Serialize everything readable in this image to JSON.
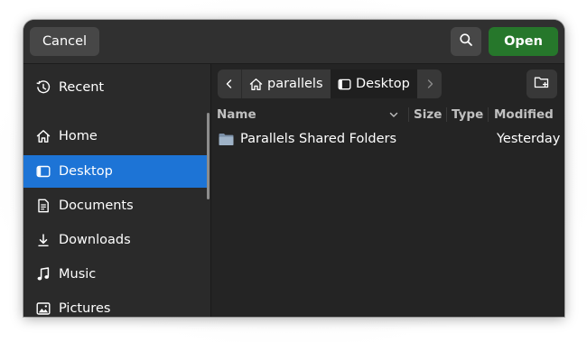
{
  "header": {
    "cancel_label": "Cancel",
    "search_icon": "search-icon",
    "open_label": "Open"
  },
  "sidebar": {
    "items": [
      {
        "label": "Recent",
        "icon": "clock-icon",
        "active": false
      },
      {
        "label": "Home",
        "icon": "home-icon",
        "active": false
      },
      {
        "label": "Desktop",
        "icon": "desktop-icon",
        "active": true
      },
      {
        "label": "Documents",
        "icon": "document-icon",
        "active": false
      },
      {
        "label": "Downloads",
        "icon": "download-icon",
        "active": false
      },
      {
        "label": "Music",
        "icon": "music-icon",
        "active": false
      },
      {
        "label": "Pictures",
        "icon": "picture-icon",
        "active": false
      }
    ]
  },
  "pathbar": {
    "crumbs": [
      "parallels",
      "Desktop"
    ],
    "current": "Desktop"
  },
  "columns": [
    "Name",
    "Size",
    "Type",
    "Modified"
  ],
  "files": [
    {
      "name": "Parallels Shared Folders",
      "size": "",
      "type": "",
      "modified": "Yesterday",
      "icon": "folder-icon"
    }
  ],
  "colors": {
    "accent": "#1d74d6",
    "open_button": "#26772b",
    "background": "#242424",
    "sidebar": "#2a2a2a"
  }
}
